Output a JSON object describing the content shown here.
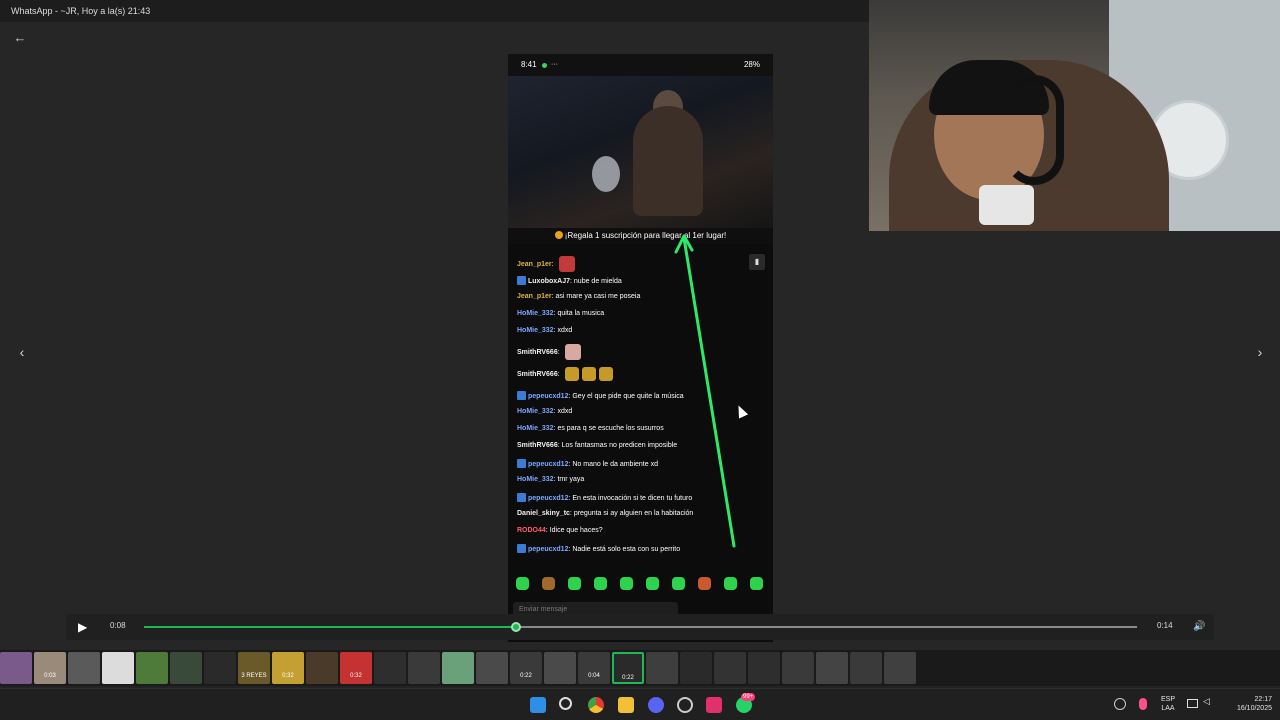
{
  "window": {
    "title": "WhatsApp - ~JR, Hoy a la(s) 21:43"
  },
  "icons": {
    "back": "←",
    "prev": "‹",
    "next": "›",
    "play": "▶",
    "volume": "🔊",
    "pin": "📌"
  },
  "phone": {
    "status_time": "8:41",
    "status_more": "···",
    "status_right": "28%",
    "banner": "¡Regala 1 suscripción para llegar al 1er lugar!",
    "chat_input_placeholder": "Enviar mensaje",
    "chat": [
      {
        "user": "Jean_p1er",
        "text": "",
        "color": "gold",
        "badge": false,
        "emote": "red"
      },
      {
        "user": "LuxoboxAJ7",
        "text": "nube de mielda",
        "color": "white",
        "badge": true
      },
      {
        "user": "Jean_p1er",
        "text": "asi mare ya casi me poseia",
        "color": "gold",
        "badge": false
      },
      {
        "user": "HoMie_332",
        "text": "quita la musica",
        "color": "blue",
        "badge": false
      },
      {
        "user": "HoMie_332",
        "text": "xdxd",
        "color": "blue",
        "badge": false
      },
      {
        "user": "SmithRV666",
        "text": "",
        "color": "white",
        "badge": false,
        "emote": "cat"
      },
      {
        "user": "SmithRV666",
        "text": "",
        "color": "white",
        "badge": false,
        "emote": "gold3"
      },
      {
        "user": "pepeucxd12",
        "text": "Gey el que pide que quite la música",
        "color": "blue",
        "badge": true
      },
      {
        "user": "HoMie_332",
        "text": "xdxd",
        "color": "blue",
        "badge": false
      },
      {
        "user": "HoMie_332",
        "text": "es para q se escuche los susurros",
        "color": "blue",
        "badge": false
      },
      {
        "user": "SmithRV666",
        "text": "Los fantasmas no predicen imposible",
        "color": "white",
        "badge": false
      },
      {
        "user": "pepeucxd12",
        "text": "No mano le da ambiente xd",
        "color": "blue",
        "badge": true
      },
      {
        "user": "HoMie_332",
        "text": "tmr yaya",
        "color": "blue",
        "badge": false
      },
      {
        "user": "pepeucxd12",
        "text": "En esta invocación si te dicen tu futuro",
        "color": "blue",
        "badge": true
      },
      {
        "user": "Daniel_skiny_tc",
        "text": "pregunta si ay alguien en la habitación",
        "color": "white",
        "badge": false
      },
      {
        "user": "RODO44",
        "text": "Idice que haces?",
        "color": "red",
        "badge": false
      },
      {
        "user": "pepeucxd12",
        "text": "Nadie está solo esta con su perrito",
        "color": "blue",
        "badge": true
      }
    ]
  },
  "player": {
    "current_time": "0:08",
    "total_time": "0:14",
    "progress": 0.375
  },
  "thumbnails": {
    "labels": [
      "0:03",
      "3 REYES",
      "0:32",
      "0:32",
      "0:22",
      "0:04",
      "0:22"
    ]
  },
  "tray": {
    "lang_top": "ESP",
    "lang_bottom": "LAA",
    "time": "22:17",
    "date": "16/10/2025",
    "badge": "99+"
  },
  "colors": {
    "accent_green": "#1db954",
    "arrow_green": "#2ee86a"
  }
}
